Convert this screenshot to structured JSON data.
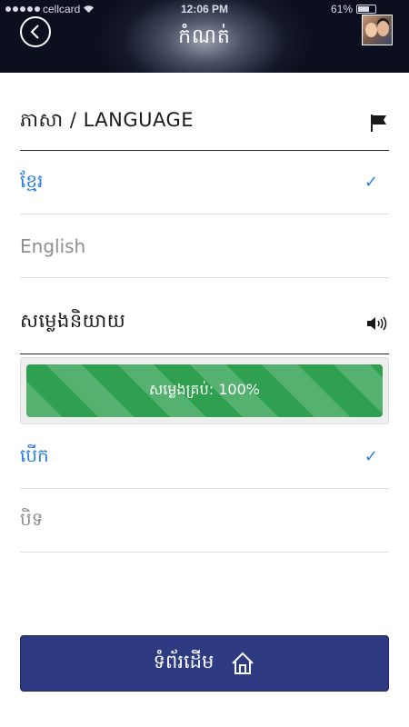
{
  "status_bar": {
    "carrier": "cellcard",
    "time": "12:06 PM",
    "battery": "61%"
  },
  "header": {
    "title": "កំណត់",
    "back_icon": "back-arrow-icon",
    "avatar_icon": "profile-avatar"
  },
  "language": {
    "heading": "ភាសា / LANGUAGE",
    "heading_icon": "flag-icon",
    "options": [
      {
        "label": "ខ្មែរ",
        "selected": true
      },
      {
        "label": "English",
        "selected": false
      }
    ]
  },
  "voice": {
    "heading": "សម្លេងនិយាយ",
    "heading_icon": "speaker-icon",
    "volume_label": "សម្លេងគ្រប់: 100%",
    "volume_percent": 100,
    "options": [
      {
        "label": "បើក",
        "selected": true
      },
      {
        "label": "បិទ",
        "selected": false
      }
    ]
  },
  "check_mark": "✓",
  "home_button": {
    "label": "ទំព័រដើម",
    "icon": "home-icon"
  },
  "colors": {
    "accent": "#2a7de1",
    "progress": "#2fa04f",
    "home_button": "#2e3a82",
    "header_dark": "#0c0f1e"
  }
}
